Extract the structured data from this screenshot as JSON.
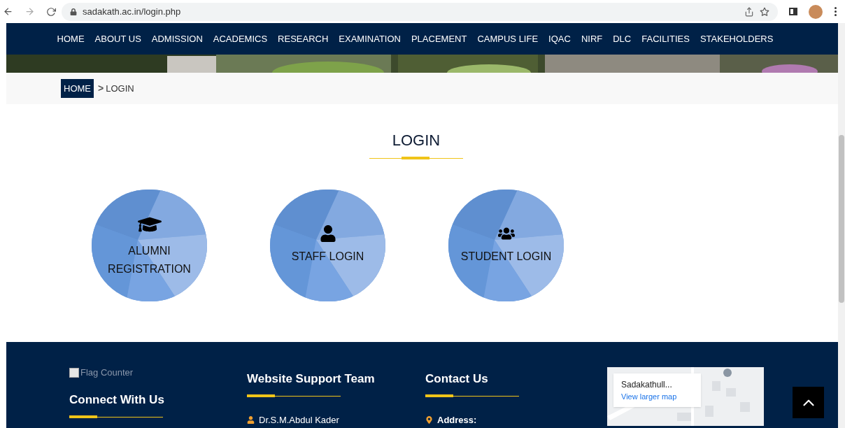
{
  "browser": {
    "url": "sadakath.ac.in/login.php"
  },
  "nav": {
    "items": [
      "HOME",
      "ABOUT US",
      "ADMISSION",
      "ACADEMICS",
      "RESEARCH",
      "EXAMINATION",
      "PLACEMENT",
      "CAMPUS LIFE",
      "IQAC",
      "NIRF",
      "DLC",
      "FACILITIES",
      "STAKEHOLDERS"
    ]
  },
  "breadcrumb": {
    "home": "HOME",
    "separator": ">",
    "current": "LOGIN"
  },
  "heading": "LOGIN",
  "login_options": [
    {
      "kind": "graduation",
      "lines": [
        "ALUMNI",
        "REGISTRATION"
      ]
    },
    {
      "kind": "user",
      "lines": [
        "STAFF LOGIN"
      ]
    },
    {
      "kind": "group",
      "lines": [
        "STUDENT LOGIN"
      ]
    }
  ],
  "footer": {
    "counter_alt": "Flag Counter",
    "columns": [
      {
        "title": "Connect With Us"
      },
      {
        "title": "Website Support Team",
        "items": [
          {
            "kind": "person",
            "text": "Dr.S.M.Abdul Kader"
          }
        ]
      },
      {
        "title": "Contact Us",
        "items": [
          {
            "kind": "pin",
            "text": "Address:"
          }
        ]
      }
    ],
    "map": {
      "place": "Sadakathull...",
      "link": "View larger map"
    }
  }
}
